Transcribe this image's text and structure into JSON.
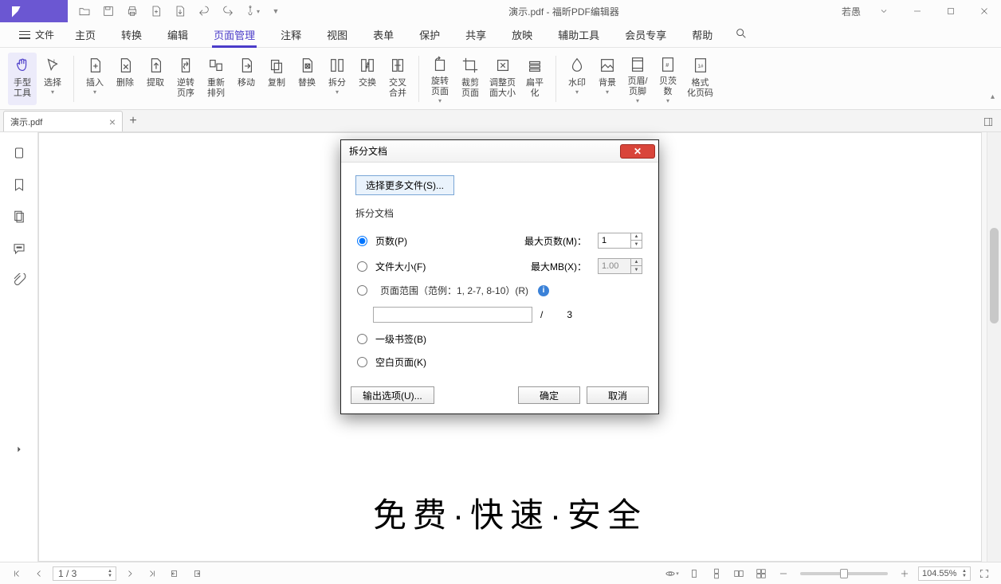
{
  "title": "演示.pdf - 福昕PDF编辑器",
  "user": "若愚",
  "file_label": "文件",
  "menu": [
    "主页",
    "转换",
    "编辑",
    "页面管理",
    "注释",
    "视图",
    "表单",
    "保护",
    "共享",
    "放映",
    "辅助工具",
    "会员专享",
    "帮助"
  ],
  "menu_active_index": 3,
  "ribbon": {
    "hand": "手型\n工具",
    "select": "选择",
    "insert": "插入",
    "delete": "删除",
    "extract": "提取",
    "reverse": "逆转\n页序",
    "rearrange": "重新\n排列",
    "move": "移动",
    "copy": "复制",
    "replace": "替换",
    "split": "拆分",
    "swap": "交换",
    "cross_merge": "交叉\n合并",
    "rotate": "旋转\n页面",
    "crop": "裁剪\n页面",
    "resize": "调整页\n面大小",
    "flatten": "扁平\n化",
    "watermark": "水印",
    "background": "背景",
    "header_footer": "页眉/\n页脚",
    "bates": "贝茨\n数",
    "format_code": "格式\n化页码"
  },
  "tab": {
    "name": "演示.pdf"
  },
  "page_content": "免费·快速·安全",
  "dialog": {
    "title": "拆分文档",
    "select_more": "选择更多文件(S)...",
    "group": "拆分文档",
    "opt_pages": "页数(P)",
    "max_pages_label": "最大页数(M)：",
    "max_pages_value": "1",
    "opt_filesize": "文件大小(F)",
    "max_mb_label": "最大MB(X)：",
    "max_mb_value": "1.00",
    "opt_range": "页面范围（范例：1, 2-7, 8-10）(R)",
    "range_sep": "/",
    "range_total": "3",
    "opt_bookmark": "一级书签(B)",
    "opt_blank": "空白页面(K)",
    "output_options": "输出选项(U)...",
    "ok": "确定",
    "cancel": "取消"
  },
  "status": {
    "page": "1 / 3",
    "zoom": "104.55%"
  }
}
